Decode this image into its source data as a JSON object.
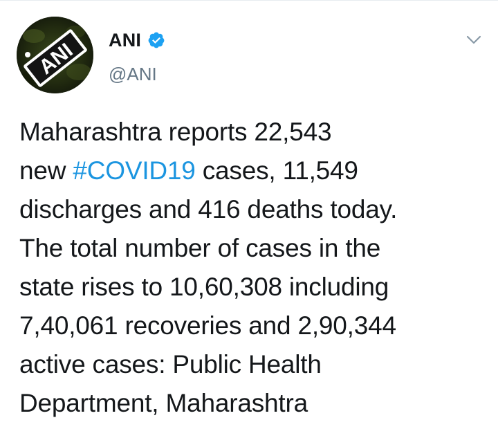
{
  "author": {
    "display_name": "ANI",
    "handle": "@ANI",
    "avatar_text": "ANI",
    "verified": true
  },
  "tweet": {
    "line1": "Maharashtra reports 22,543",
    "line2_pre": "new ",
    "line2_hashtag": "#COVID19",
    "line2_post": " cases, 11,549",
    "line3": "discharges and 416 deaths today.",
    "line4": "The total number of cases in the",
    "line5": "state rises to 10,60,308 including",
    "line6": "7,40,061 recoveries and 2,90,344",
    "line7": "active cases: Public Health",
    "line8": "Department, Maharashtra"
  },
  "icons": {
    "verified": "verified-badge-icon",
    "menu": "chevron-down-icon"
  },
  "colors": {
    "text": "#14171a",
    "secondary": "#657786",
    "link": "#1b95e0",
    "verified": "#1da1f2"
  }
}
